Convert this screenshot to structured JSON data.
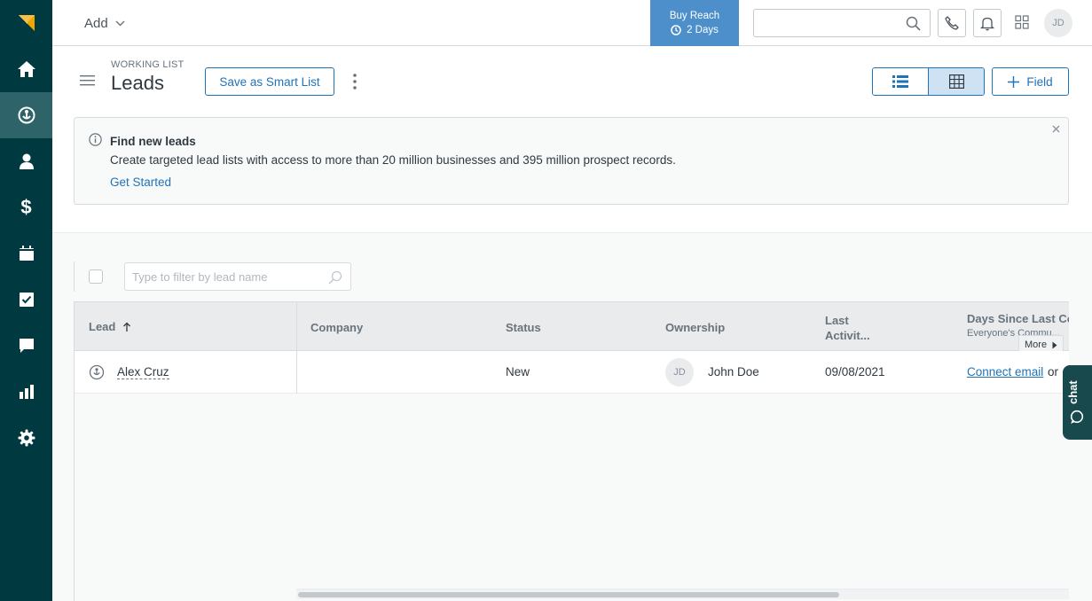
{
  "topbar": {
    "add_label": "Add",
    "buy_reach": {
      "line1": "Buy Reach",
      "line2": "2 Days"
    },
    "search_placeholder": "",
    "avatar_initials": "JD"
  },
  "sidebar": {
    "items": [
      {
        "name": "logo",
        "icon": "zendesk-sell-logo"
      },
      {
        "name": "home",
        "icon": "home-icon"
      },
      {
        "name": "leads",
        "icon": "leads-icon",
        "active": true
      },
      {
        "name": "contacts",
        "icon": "person-icon"
      },
      {
        "name": "deals",
        "icon": "dollar-icon"
      },
      {
        "name": "calendar",
        "icon": "calendar-icon"
      },
      {
        "name": "tasks",
        "icon": "checkbox-icon"
      },
      {
        "name": "communication",
        "icon": "chat-bubble-icon"
      },
      {
        "name": "reports",
        "icon": "bar-chart-icon"
      },
      {
        "name": "settings",
        "icon": "gear-icon"
      }
    ]
  },
  "header": {
    "eyebrow": "WORKING LIST",
    "title": "Leads",
    "save_smart_list_label": "Save as Smart List",
    "field_button_label": "Field"
  },
  "banner": {
    "title": "Find new leads",
    "body": "Create targeted lead lists with access to more than 20 million businesses and 395 million prospect records.",
    "link": "Get Started"
  },
  "filter": {
    "placeholder": "Type to filter by lead name"
  },
  "table": {
    "headers": {
      "lead": "Lead",
      "company": "Company",
      "status": "Status",
      "ownership": "Ownership",
      "last_activity_line1": "Last",
      "last_activity_line2": "Activit...",
      "days_since": "Days Since Last Co",
      "days_since_sub": "Everyone's Commu..."
    },
    "more_label": "More",
    "rows": [
      {
        "lead": "Alex Cruz",
        "company": "",
        "status": "New",
        "owner_initials": "JD",
        "owner_name": "John Doe",
        "last_activity": "09/08/2021",
        "days_since_link": "Connect email",
        "days_since_suffix": "or"
      }
    ]
  },
  "chat": {
    "label": "chat"
  },
  "colors": {
    "sidebar": "#003a40",
    "sidebar_active": "#2e6469",
    "accent": "#1f73b7",
    "buy_reach": "#4d8fcb",
    "chat_tab": "#17494d"
  }
}
